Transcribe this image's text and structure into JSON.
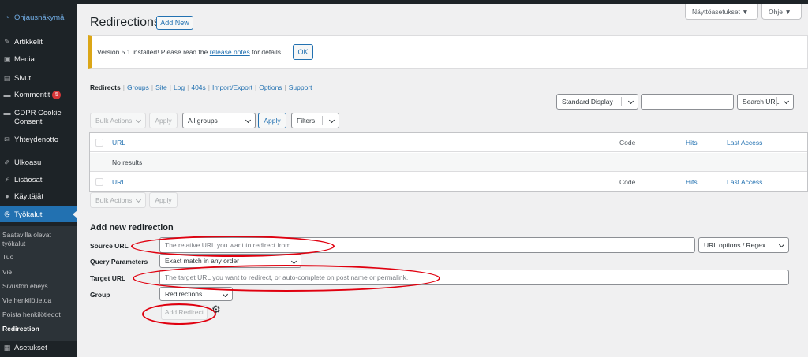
{
  "sidebar": {
    "dashboard": "Ohjausnäkymä",
    "items": [
      {
        "label": "Artikkelit",
        "icon": "pin-icon"
      },
      {
        "label": "Media",
        "icon": "media-icon"
      },
      {
        "label": "Sivut",
        "icon": "page-icon"
      },
      {
        "label": "Kommentit",
        "icon": "comment-icon",
        "badge": "5"
      },
      {
        "label": "GDPR Cookie Consent",
        "icon": "cookie-icon"
      },
      {
        "label": "Yhteydenotto",
        "icon": "mail-icon"
      },
      {
        "label": "Ulkoasu",
        "icon": "brush-icon"
      },
      {
        "label": "Lisäosat",
        "icon": "plugin-icon"
      },
      {
        "label": "Käyttäjät",
        "icon": "user-icon"
      },
      {
        "label": "Työkalut",
        "icon": "wrench-icon"
      }
    ],
    "submenu": [
      "Saatavilla olevat työkalut",
      "Tuo",
      "Vie",
      "Sivuston eheys",
      "Vie henkilötietoa",
      "Poista henkilötiedot",
      "Redirection"
    ],
    "settings": "Asetukset"
  },
  "header": {
    "title": "Redirections",
    "add_new": "Add New",
    "screen_options": "Näyttöasetukset ▼",
    "help": "Ohje ▼"
  },
  "notice": {
    "before": "Version 5.1 installed! Please read the ",
    "link": "release notes",
    "after": " for details.",
    "ok": "OK"
  },
  "subnav": {
    "current": "Redirects",
    "links": [
      "Groups",
      "Site",
      "Log",
      "404s",
      "Import/Export",
      "Options",
      "Support"
    ]
  },
  "toolbar": {
    "display": "Standard Display",
    "search_placeholder": "",
    "search_button": "Search URL",
    "bulk_actions": "Bulk Actions",
    "apply": "Apply",
    "group_filter": "All groups",
    "filters": "Filters"
  },
  "table": {
    "col_url": "URL",
    "col_code": "Code",
    "col_hits": "Hits",
    "col_last": "Last Access",
    "empty": "No results"
  },
  "form": {
    "title": "Add new redirection",
    "source_label": "Source URL",
    "source_placeholder": "The relative URL you want to redirect from",
    "url_options": "URL options / Regex",
    "query_label": "Query Parameters",
    "query_value": "Exact match in any order",
    "target_label": "Target URL",
    "target_placeholder": "The target URL you want to redirect, or auto-complete on post name or permalink.",
    "group_label": "Group",
    "group_value": "Redirections",
    "add_button": "Add Redirect"
  },
  "colors": {
    "accent": "#2271b1",
    "sidebar": "#1d2327",
    "highlight_ellipse": "#e0000f",
    "notice_border": "#dba617"
  }
}
